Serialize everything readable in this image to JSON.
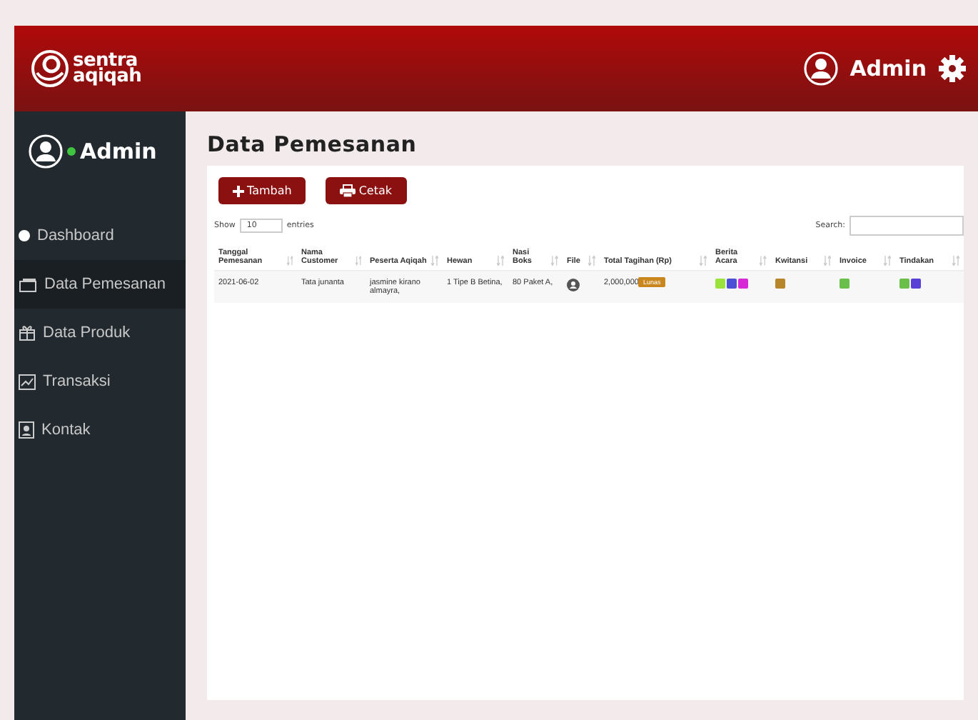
{
  "header": {
    "logo_line_1": "sentra",
    "logo_line_2": "aqiqah",
    "user": "Admin"
  },
  "sidebar": {
    "user": "Admin",
    "online": true,
    "items": [
      {
        "label": "Dashboard",
        "kind": "dot",
        "selected": false
      },
      {
        "label": "Data Pemesanan",
        "kind": "cash",
        "selected": true
      },
      {
        "label": "Data Produk",
        "kind": "gift",
        "selected": false
      },
      {
        "label": "Transaksi",
        "kind": "chart",
        "selected": false
      },
      {
        "label": "Kontak",
        "kind": "contact",
        "selected": false
      }
    ]
  },
  "page": {
    "title": "Data Pemesanan",
    "buttons": [
      {
        "label": "Tambah",
        "kind": "plus"
      },
      {
        "label": "Cetak",
        "kind": "print"
      }
    ]
  },
  "table_controls": {
    "show_label": "Show",
    "page_size": "10",
    "entries_label": "entries",
    "search_label": "Search:"
  },
  "table": {
    "columns": [
      "Tanggal Pemesanan",
      "Nama Customer",
      "Peserta Aqiqah",
      "Hewan",
      "Nasi Boks",
      "File",
      "Total Tagihan (Rp)",
      "Berita Acara",
      "Kwitansi",
      "Invoice",
      "Tindakan"
    ],
    "rows": [
      {
        "tanggal": "2021-06-02",
        "customer": "Tata junanta",
        "peserta": "jasmine kirano almayra,",
        "hewan": "1 Tipe B Betina,",
        "nasi_boks": "80 Paket A,",
        "total": "2,000,000",
        "status": "Lunas",
        "berita_acara": [
          {
            "color": "#9be23c"
          },
          {
            "color": "#4b4fd6"
          },
          {
            "color": "#d62ad6"
          }
        ],
        "kwitansi": [
          {
            "color": "#b8862a"
          }
        ],
        "invoice": [
          {
            "color": "#6abf4b"
          }
        ],
        "tindakan": [
          {
            "color": "#6abf4b"
          },
          {
            "color": "#5a3fd6"
          }
        ]
      }
    ]
  }
}
